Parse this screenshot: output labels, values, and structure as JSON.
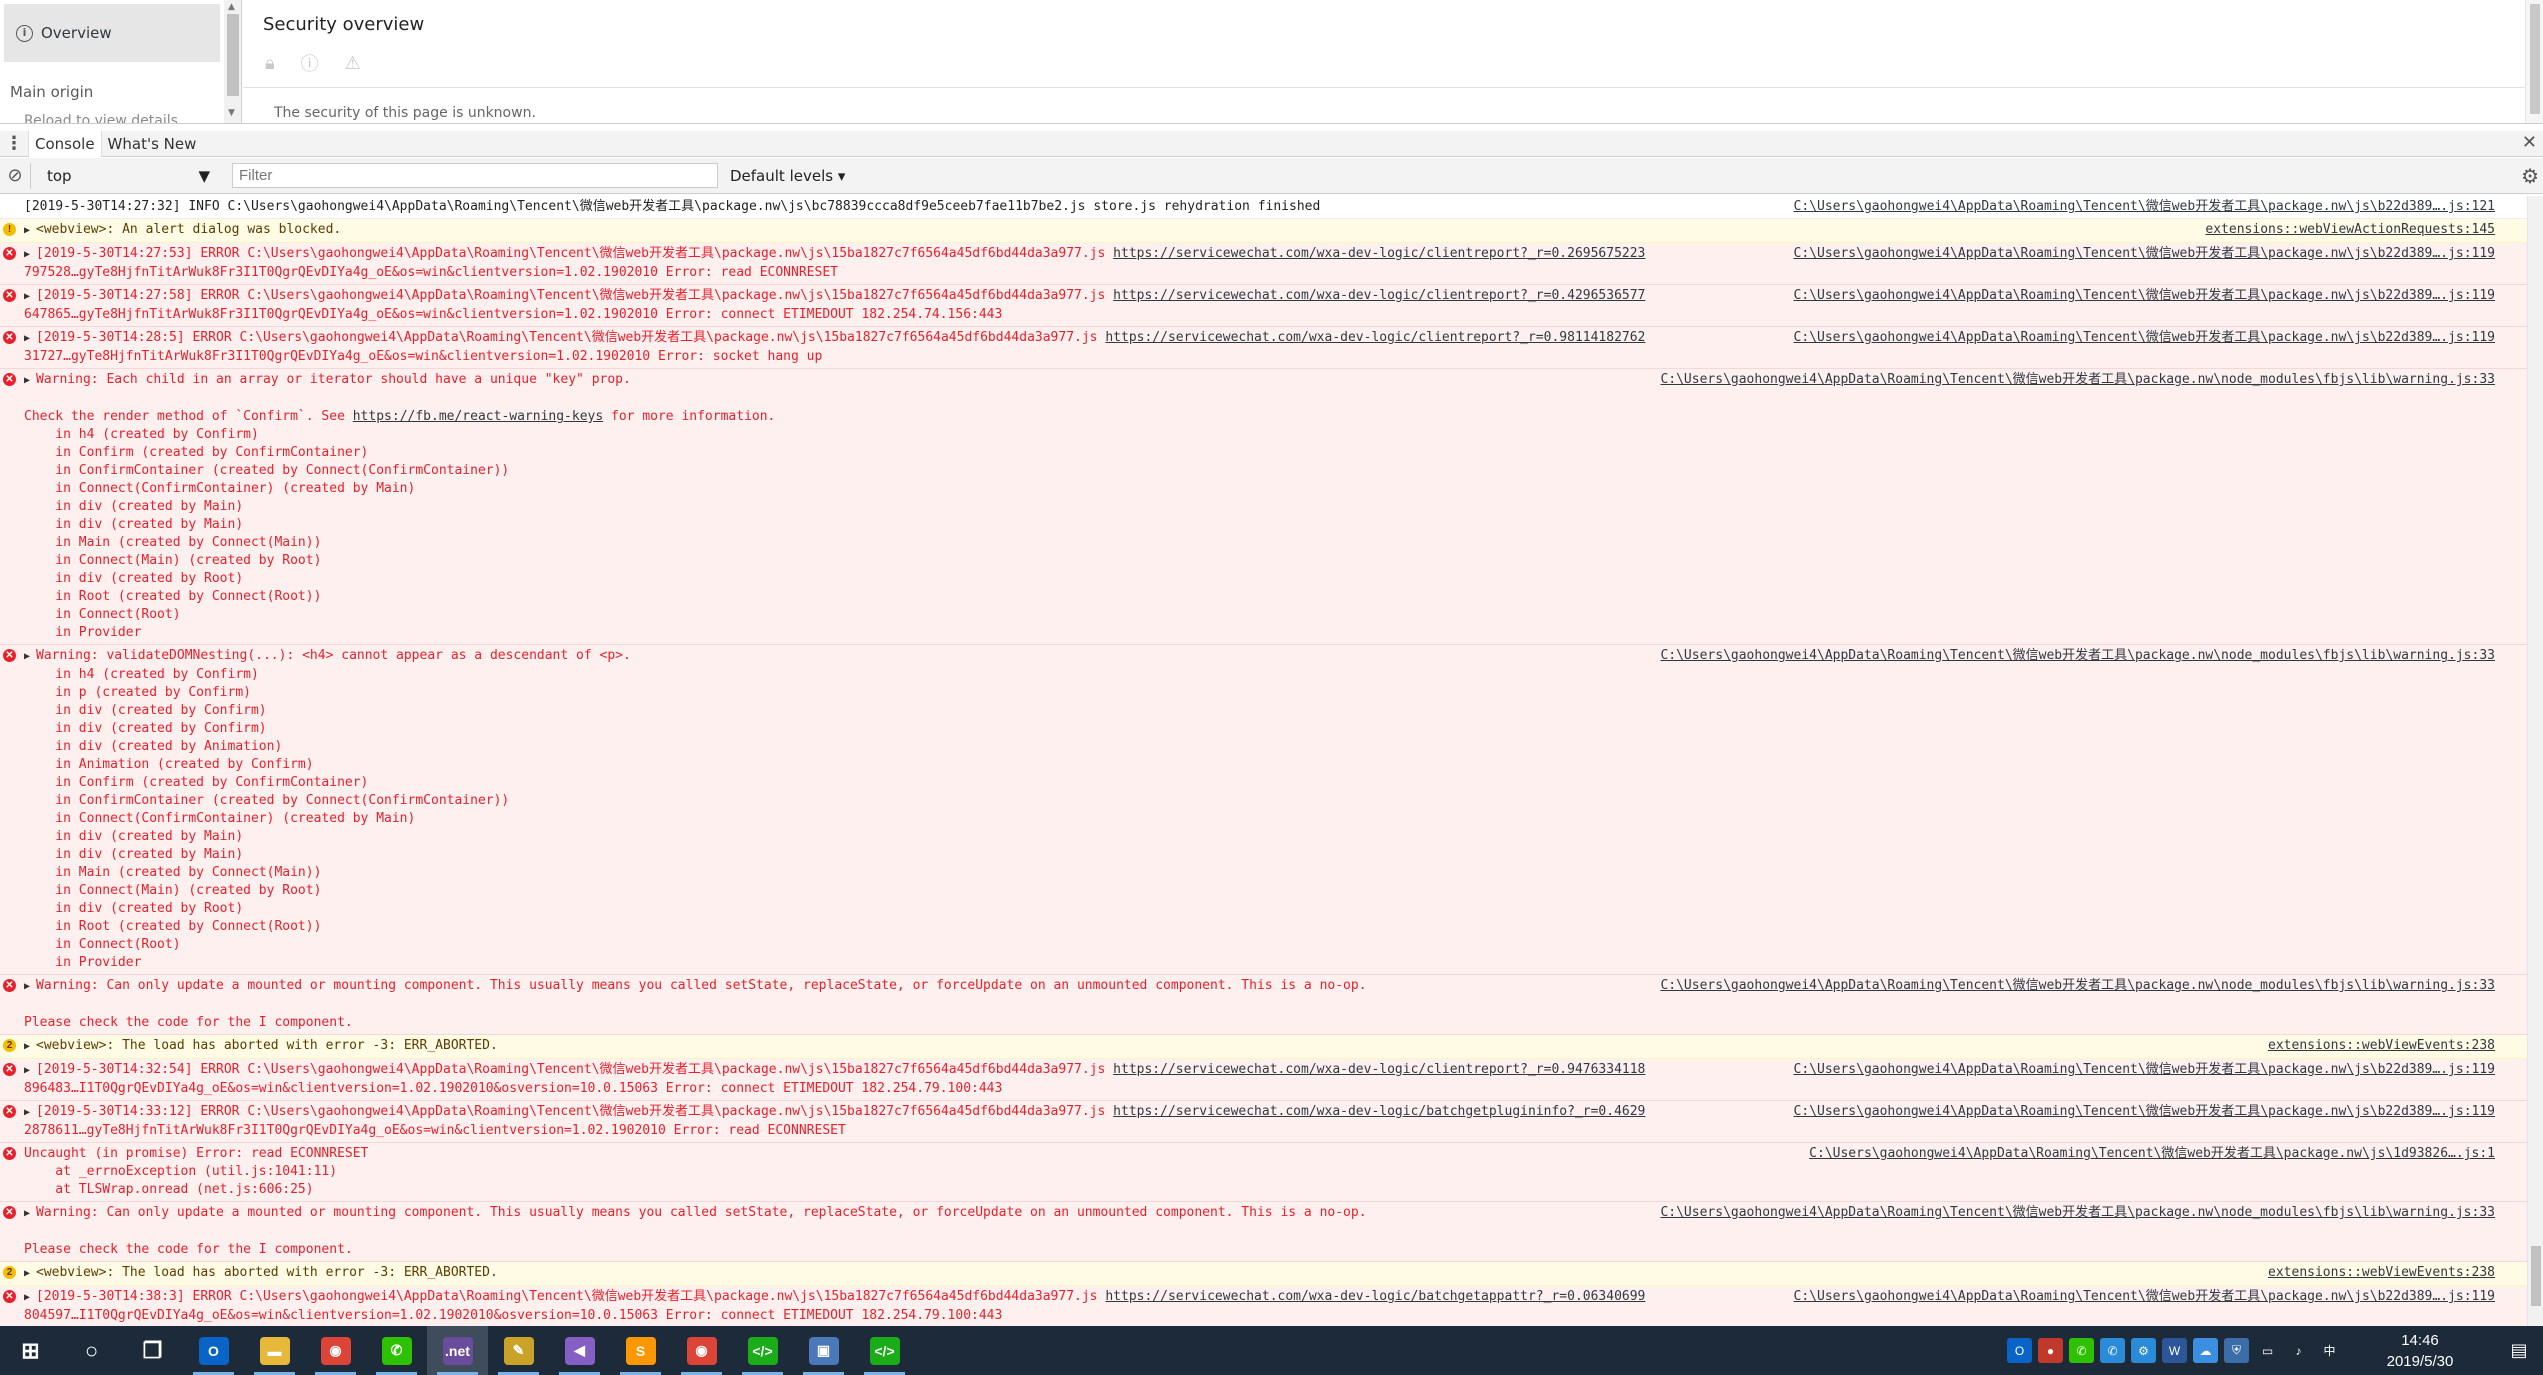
{
  "security": {
    "side": {
      "overview_label": "Overview",
      "main_origin": "Main origin",
      "reload_hint": "Reload to view details"
    },
    "title": "Security overview",
    "unknown_text": "The security of this page is unknown."
  },
  "drawer": {
    "tabs": [
      "Console",
      "What's New"
    ]
  },
  "toolbar": {
    "context": "top",
    "filter_placeholder": "Filter",
    "levels": "Default levels ▾"
  },
  "messages": [
    {
      "level": "info",
      "text": "[2019-5-30T14:27:32] INFO C:\\Users\\gaohongwei4\\AppData\\Roaming\\Tencent\\微信web开发者工具\\package.nw\\js\\bc78839ccca8df9e5ceeb7fae11b7be2.js store.js rehydration finished",
      "source": "C:\\Users\\gaohongwei4\\AppData\\Roaming\\Tencent\\微信web开发者工具\\package.nw\\js\\b22d389….js:121"
    },
    {
      "level": "warning",
      "expand": true,
      "text": "<webview>: An alert dialog was blocked.",
      "source": "extensions::webViewActionRequests:145"
    },
    {
      "level": "error",
      "expand": true,
      "text": "[2019-5-30T14:27:53] ERROR C:\\Users\\gaohongwei4\\AppData\\Roaming\\Tencent\\微信web开发者工具\\package.nw\\js\\15ba1827c7f6564a45df6bd44da3a977.js ",
      "url": "https://servicewechat.com/wxa-dev-logic/clientreport?_r=0.2695675223",
      "cont": "797528…gyTe8HjfnTitArWuk8Fr3I1T0QgrQEvDIYa4g_oE&os=win&clientversion=1.02.1902010 Error: read ECONNRESET",
      "source": "C:\\Users\\gaohongwei4\\AppData\\Roaming\\Tencent\\微信web开发者工具\\package.nw\\js\\b22d389….js:119"
    },
    {
      "level": "error",
      "expand": true,
      "text": "[2019-5-30T14:27:58] ERROR C:\\Users\\gaohongwei4\\AppData\\Roaming\\Tencent\\微信web开发者工具\\package.nw\\js\\15ba1827c7f6564a45df6bd44da3a977.js ",
      "url": "https://servicewechat.com/wxa-dev-logic/clientreport?_r=0.4296536577",
      "cont": "647865…gyTe8HjfnTitArWuk8Fr3I1T0QgrQEvDIYa4g_oE&os=win&clientversion=1.02.1902010 Error: connect ETIMEDOUT 182.254.74.156:443",
      "source": "C:\\Users\\gaohongwei4\\AppData\\Roaming\\Tencent\\微信web开发者工具\\package.nw\\js\\b22d389….js:119"
    },
    {
      "level": "error",
      "expand": true,
      "text": "[2019-5-30T14:28:5] ERROR C:\\Users\\gaohongwei4\\AppData\\Roaming\\Tencent\\微信web开发者工具\\package.nw\\js\\15ba1827c7f6564a45df6bd44da3a977.js ",
      "url": "https://servicewechat.com/wxa-dev-logic/clientreport?_r=0.98114182762",
      "cont": "31727…gyTe8HjfnTitArWuk8Fr3I1T0QgrQEvDIYa4g_oE&os=win&clientversion=1.02.1902010 Error: socket hang up",
      "source": "C:\\Users\\gaohongwei4\\AppData\\Roaming\\Tencent\\微信web开发者工具\\package.nw\\js\\b22d389….js:119"
    },
    {
      "level": "error",
      "expand": true,
      "text": "Warning: Each child in an array or iterator should have a unique \"key\" prop.",
      "source": "C:\\Users\\gaohongwei4\\AppData\\Roaming\\Tencent\\微信web开发者工具\\package.nw\\node_modules\\fbjs\\lib\\warning.js:33",
      "blank": true,
      "after_pre": "Check the render method of `Confirm`. See ",
      "after_url": "https://fb.me/react-warning-keys",
      "after_post": " for more information.",
      "stack": "    in h4 (created by Confirm)\n    in Confirm (created by ConfirmContainer)\n    in ConfirmContainer (created by Connect(ConfirmContainer))\n    in Connect(ConfirmContainer) (created by Main)\n    in div (created by Main)\n    in div (created by Main)\n    in Main (created by Connect(Main))\n    in Connect(Main) (created by Root)\n    in div (created by Root)\n    in Root (created by Connect(Root))\n    in Connect(Root)\n    in Provider"
    },
    {
      "level": "error",
      "expand": true,
      "text": "Warning: validateDOMNesting(...): <h4> cannot appear as a descendant of <p>.",
      "source": "C:\\Users\\gaohongwei4\\AppData\\Roaming\\Tencent\\微信web开发者工具\\package.nw\\node_modules\\fbjs\\lib\\warning.js:33",
      "stack": "    in h4 (created by Confirm)\n    in p (created by Confirm)\n    in div (created by Confirm)\n    in div (created by Confirm)\n    in div (created by Animation)\n    in Animation (created by Confirm)\n    in Confirm (created by ConfirmContainer)\n    in ConfirmContainer (created by Connect(ConfirmContainer))\n    in Connect(ConfirmContainer) (created by Main)\n    in div (created by Main)\n    in div (created by Main)\n    in Main (created by Connect(Main))\n    in Connect(Main) (created by Root)\n    in div (created by Root)\n    in Root (created by Connect(Root))\n    in Connect(Root)\n    in Provider"
    },
    {
      "level": "error",
      "expand": true,
      "text": "Warning: Can only update a mounted or mounting component. This usually means you called setState, replaceState, or forceUpdate on an unmounted component. This is a no-op.",
      "source": "C:\\Users\\gaohongwei4\\AppData\\Roaming\\Tencent\\微信web开发者工具\\package.nw\\node_modules\\fbjs\\lib\\warning.js:33",
      "blank": true,
      "after_pre": "Please check the code for the I component."
    },
    {
      "level": "warning",
      "count": "2",
      "expand": true,
      "text": "<webview>: The load has aborted with error -3: ERR_ABORTED.",
      "source": "extensions::webViewEvents:238"
    },
    {
      "level": "error",
      "expand": true,
      "text": "[2019-5-30T14:32:54] ERROR C:\\Users\\gaohongwei4\\AppData\\Roaming\\Tencent\\微信web开发者工具\\package.nw\\js\\15ba1827c7f6564a45df6bd44da3a977.js ",
      "url": "https://servicewechat.com/wxa-dev-logic/clientreport?_r=0.9476334118",
      "cont": "896483…I1T0QgrQEvDIYa4g_oE&os=win&clientversion=1.02.1902010&osversion=10.0.15063 Error: connect ETIMEDOUT 182.254.79.100:443",
      "source": "C:\\Users\\gaohongwei4\\AppData\\Roaming\\Tencent\\微信web开发者工具\\package.nw\\js\\b22d389….js:119"
    },
    {
      "level": "error",
      "expand": true,
      "text": "[2019-5-30T14:33:12] ERROR C:\\Users\\gaohongwei4\\AppData\\Roaming\\Tencent\\微信web开发者工具\\package.nw\\js\\15ba1827c7f6564a45df6bd44da3a977.js ",
      "url": "https://servicewechat.com/wxa-dev-logic/batchgetplugininfo?_r=0.4629",
      "cont": "2878611…gyTe8HjfnTitArWuk8Fr3I1T0QgrQEvDIYa4g_oE&os=win&clientversion=1.02.1902010 Error: read ECONNRESET",
      "source": "C:\\Users\\gaohongwei4\\AppData\\Roaming\\Tencent\\微信web开发者工具\\package.nw\\js\\b22d389….js:119"
    },
    {
      "level": "error",
      "expand": false,
      "text": "Uncaught (in promise) Error: read ECONNRESET",
      "source": "C:\\Users\\gaohongwei4\\AppData\\Roaming\\Tencent\\微信web开发者工具\\package.nw\\js\\1d93826….js:1",
      "stack": "    at _errnoException (util.js:1041:11)\n    at TLSWrap.onread (net.js:606:25)"
    },
    {
      "level": "error",
      "expand": true,
      "text": "Warning: Can only update a mounted or mounting component. This usually means you called setState, replaceState, or forceUpdate on an unmounted component. This is a no-op.",
      "source": "C:\\Users\\gaohongwei4\\AppData\\Roaming\\Tencent\\微信web开发者工具\\package.nw\\node_modules\\fbjs\\lib\\warning.js:33",
      "blank": true,
      "after_pre": "Please check the code for the I component."
    },
    {
      "level": "warning",
      "count": "2",
      "expand": true,
      "text": "<webview>: The load has aborted with error -3: ERR_ABORTED.",
      "source": "extensions::webViewEvents:238"
    },
    {
      "level": "error",
      "expand": true,
      "text": "[2019-5-30T14:38:3] ERROR C:\\Users\\gaohongwei4\\AppData\\Roaming\\Tencent\\微信web开发者工具\\package.nw\\js\\15ba1827c7f6564a45df6bd44da3a977.js ",
      "url": "https://servicewechat.com/wxa-dev-logic/batchgetappattr?_r=0.06340699",
      "cont": "804597…I1T0QgrQEvDIYa4g_oE&os=win&clientversion=1.02.1902010&osversion=10.0.15063 Error: connect ETIMEDOUT 182.254.79.100:443",
      "source": "C:\\Users\\gaohongwei4\\AppData\\Roaming\\Tencent\\微信web开发者工具\\package.nw\\js\\b22d389….js:119"
    }
  ],
  "taskbar": {
    "apps": [
      {
        "name": "start-button",
        "icon": "windows-icon",
        "glyph": "⊞",
        "color": "transparent"
      },
      {
        "name": "search-button",
        "icon": "search-icon",
        "glyph": "○",
        "color": "transparent"
      },
      {
        "name": "task-view-button",
        "icon": "task-view-icon",
        "glyph": "❐",
        "color": "transparent"
      },
      {
        "name": "outlook-app",
        "icon": "outlook-icon",
        "glyph": "O",
        "color": "#0a64c8"
      },
      {
        "name": "file-explorer-app",
        "icon": "folder-icon",
        "glyph": "▬",
        "color": "#e8b83a"
      },
      {
        "name": "chrome-app",
        "icon": "chrome-icon",
        "glyph": "◉",
        "color": "#db4437"
      },
      {
        "name": "wechat-app",
        "icon": "wechat-icon",
        "glyph": "✆",
        "color": "#2dc100"
      },
      {
        "name": "dotnet-app",
        "icon": "dotnet-icon",
        "glyph": ".net",
        "color": "#6a4c9c"
      },
      {
        "name": "editor-app",
        "icon": "editor-icon",
        "glyph": "✎",
        "color": "#c9a227"
      },
      {
        "name": "visual-studio-app",
        "icon": "visual-studio-icon",
        "glyph": "◀",
        "color": "#865fc5"
      },
      {
        "name": "sublime-app",
        "icon": "sublime-icon",
        "glyph": "S",
        "color": "#ff9800"
      },
      {
        "name": "chrome-app-2",
        "icon": "chrome-icon",
        "glyph": "◉",
        "color": "#db4437"
      },
      {
        "name": "wechat-devtools-app",
        "icon": "code-icon",
        "glyph": "</>",
        "color": "#1aad19"
      },
      {
        "name": "remote-app",
        "icon": "monitor-icon",
        "glyph": "▣",
        "color": "#4a78b8"
      },
      {
        "name": "wechat-devtools-app-2",
        "icon": "code-icon",
        "glyph": "</>",
        "color": "#1aad19"
      }
    ],
    "tray": [
      {
        "icon": "outlook-tray-icon",
        "glyph": "O",
        "color": "#0a64c8"
      },
      {
        "icon": "app-tray-icon",
        "glyph": "●",
        "color": "#c0392b"
      },
      {
        "icon": "wechat-tray-icon",
        "glyph": "✆",
        "color": "#2dc100"
      },
      {
        "icon": "wecom-tray-icon",
        "glyph": "✆",
        "color": "#2a8cd8"
      },
      {
        "icon": "network-tray-icon",
        "glyph": "⚙",
        "color": "#2a8cd8"
      },
      {
        "icon": "word-tray-icon",
        "glyph": "W",
        "color": "#2b579a"
      },
      {
        "icon": "cloud-tray-icon",
        "glyph": "☁",
        "color": "#3b8ee0"
      },
      {
        "icon": "shield-tray-icon",
        "glyph": "⛨",
        "color": "#3b6ea8"
      },
      {
        "icon": "display-tray-icon",
        "glyph": "▭",
        "color": "transparent"
      },
      {
        "icon": "volume-tray-icon",
        "glyph": "♪",
        "color": "transparent"
      },
      {
        "icon": "ime-tray-icon",
        "glyph": "中",
        "color": "transparent"
      }
    ],
    "time": "14:46",
    "date": "2019/5/30"
  },
  "colors": {
    "error_bg": "#fff0f0",
    "error_text": "#e8202a",
    "warning_bg": "#fffbe5",
    "taskbar_bg": "#1c2a3a"
  }
}
